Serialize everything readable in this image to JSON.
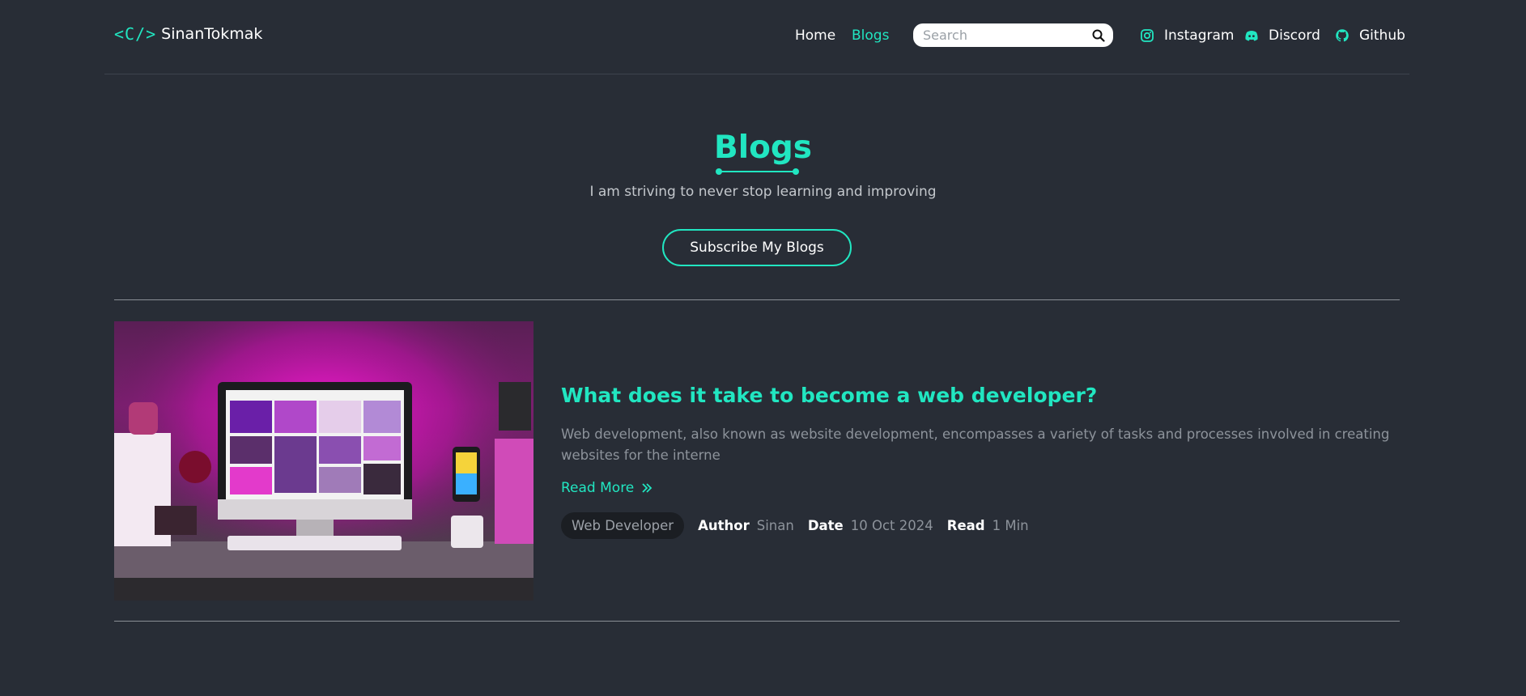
{
  "header": {
    "logo_code": "<C/>",
    "logo_name": "SinanTokmak",
    "nav": [
      {
        "label": "Home",
        "active": false
      },
      {
        "label": "Blogs",
        "active": true
      }
    ],
    "search": {
      "placeholder": "Search",
      "value": ""
    },
    "social": [
      {
        "label": "Instagram",
        "icon": "instagram-icon"
      },
      {
        "label": "Discord",
        "icon": "discord-icon"
      },
      {
        "label": "Github",
        "icon": "github-icon"
      }
    ]
  },
  "hero": {
    "title": "Blogs",
    "subtitle": "I am striving to never stop learning and improving",
    "subscribe_label": "Subscribe My Blogs"
  },
  "posts": [
    {
      "title": "What does it take to become a web developer?",
      "excerpt": "Web development, also known as website development, encompasses a variety of tasks and processes involved in creating websites for the interne",
      "read_more": "Read More",
      "tag": "Web Developer",
      "author_label": "Author",
      "author": "Sinan",
      "date_label": "Date",
      "date": "10 Oct 2024",
      "read_label": "Read",
      "read_time": "1 Min"
    }
  ],
  "colors": {
    "background": "#282d36",
    "accent": "#21e6c1",
    "text": "#ffffff",
    "muted": "#8d939b"
  }
}
